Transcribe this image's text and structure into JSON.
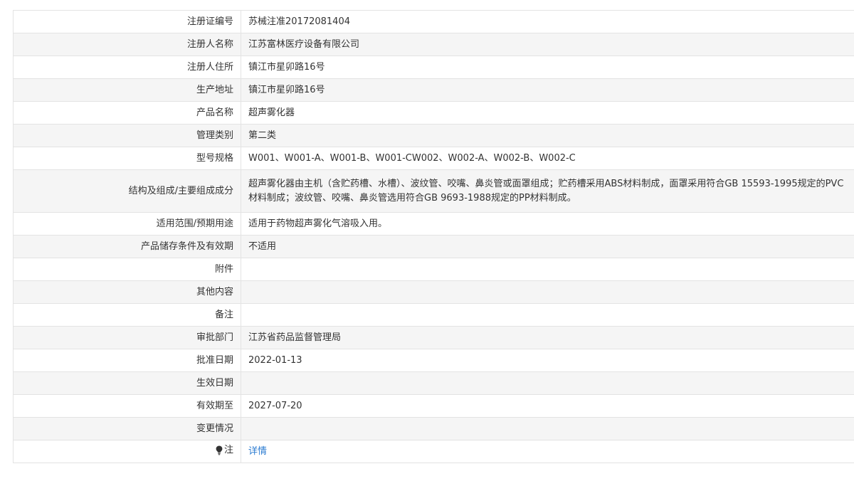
{
  "rows": [
    {
      "label": "注册证编号",
      "value": "苏械注准20172081404"
    },
    {
      "label": "注册人名称",
      "value": "江苏富林医疗设备有限公司"
    },
    {
      "label": "注册人住所",
      "value": "镇江市星卯路16号"
    },
    {
      "label": "生产地址",
      "value": "镇江市星卯路16号"
    },
    {
      "label": "产品名称",
      "value": "超声雾化器"
    },
    {
      "label": "管理类别",
      "value": "第二类"
    },
    {
      "label": "型号规格",
      "value": "W001、W001-A、W001-B、W001-CW002、W002-A、W002-B、W002-C"
    },
    {
      "label": "结构及组成/主要组成成分",
      "value": "超声雾化器由主机（含贮药槽、水槽）、波纹管、咬嘴、鼻炎管或面罩组成；贮药槽采用ABS材料制成，面罩采用符合GB 15593-1995规定的PVC材料制成；波纹管、咬嘴、鼻炎管选用符合GB 9693-1988规定的PP材料制成。"
    },
    {
      "label": "适用范围/预期用途",
      "value": "适用于药物超声雾化气溶吸入用。"
    },
    {
      "label": "产品储存条件及有效期",
      "value": "不适用"
    },
    {
      "label": "附件",
      "value": ""
    },
    {
      "label": "其他内容",
      "value": ""
    },
    {
      "label": "备注",
      "value": ""
    },
    {
      "label": "审批部门",
      "value": "江苏省药品监督管理局"
    },
    {
      "label": "批准日期",
      "value": "2022-01-13"
    },
    {
      "label": "生效日期",
      "value": ""
    },
    {
      "label": "有效期至",
      "value": "2027-07-20"
    },
    {
      "label": "变更情况",
      "value": ""
    }
  ],
  "note": {
    "icon": "lightbulb-icon",
    "label": "注",
    "link_text": "详情"
  },
  "colors": {
    "border": "#e3e3e3",
    "stripe": "#f5f5f5",
    "text": "#333333",
    "link": "#2a7bd1"
  }
}
